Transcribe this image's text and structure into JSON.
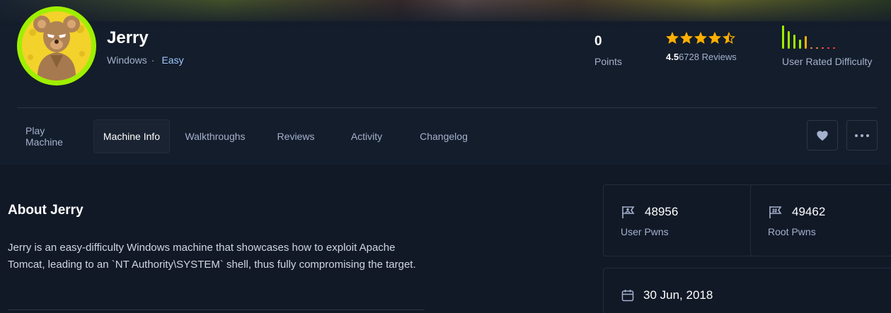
{
  "machine": {
    "name": "Jerry",
    "os": "Windows",
    "separator": "·",
    "difficulty": "Easy"
  },
  "stats": {
    "points_value": "0",
    "points_label": "Points",
    "rating_value": "4.5",
    "rating_count": "6728",
    "rating_suffix": " Reviews",
    "stars_filled": 4.5,
    "difficulty_label": "User Rated Difficulty",
    "difficulty_bar_levels": [
      1.0,
      0.75,
      0.6,
      0.4,
      0.55,
      0.05,
      0.05,
      0.05,
      0.05,
      0.05
    ]
  },
  "tabs": [
    {
      "label": "Play Machine",
      "active": false
    },
    {
      "label": "Machine Info",
      "active": true
    },
    {
      "label": "Walkthroughs",
      "active": false
    },
    {
      "label": "Reviews",
      "active": false
    },
    {
      "label": "Activity",
      "active": false
    },
    {
      "label": "Changelog",
      "active": false
    }
  ],
  "about": {
    "title": "About Jerry",
    "description": "Jerry is an easy-difficulty Windows machine that showcases how to exploit Apache Tomcat, leading to an `NT Authority\\SYSTEM` shell, thus fully compromising the target."
  },
  "cards": {
    "user_pwns_value": "48956",
    "user_pwns_label": "User Pwns",
    "root_pwns_value": "49462",
    "root_pwns_label": "Root Pwns",
    "release_date": "30 Jun, 2018"
  },
  "colors": {
    "accent_green": "#9fef00",
    "star_orange": "#ffaf00",
    "background": "#111927",
    "header_bg": "#141d2b"
  }
}
